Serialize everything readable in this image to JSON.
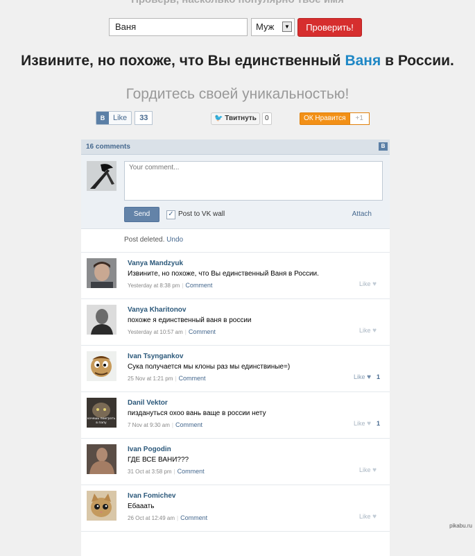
{
  "top_cut": "Проверь, насколько популярно твое имя",
  "form": {
    "name_value": "Ваня",
    "gender_value": "Муж",
    "submit_label": "Проверить!"
  },
  "result": {
    "prefix": "Извините, но похоже, что Вы единственный ",
    "name": "Ваня",
    "suffix": " в России."
  },
  "subtitle": "Гордитесь своей уникальностью!",
  "share": {
    "vk_logo": "B",
    "vk_label": "Like",
    "vk_count": "33",
    "twitter_label": "Твитнуть",
    "twitter_count": "0",
    "ok_label": "Нравится",
    "ok_plus": "+1"
  },
  "widget": {
    "header": "16 comments",
    "header_logo": "B",
    "comment_placeholder": "Your comment...",
    "send_label": "Send",
    "post_to_wall_label": "Post to VK wall",
    "attach_label": "Attach",
    "deleted_text": "Post deleted.",
    "undo_label": "Undo",
    "comments": [
      {
        "author": "Vanya Mandzyuk",
        "text": "Извините, но похоже, что Вы единственный Ваня в России.",
        "time": "Yesterday at 8:38 pm",
        "reply": "Comment",
        "like": "Like",
        "likes": ""
      },
      {
        "author": "Vanya Kharitonov",
        "text": "похоже я единственный ваня в россии",
        "time": "Yesterday at 10:57 am",
        "reply": "Comment",
        "like": "Like",
        "likes": ""
      },
      {
        "author": "Ivan Tsyngankov",
        "text": "Сука получается мы клоны раз мы единствиные=)",
        "time": "25 Nov at 1:21 pm",
        "reply": "Comment",
        "like": "Like",
        "likes": "1"
      },
      {
        "author": "Danil Vektor",
        "text": "пиздануться охоо вань ваще в россии нету",
        "time": "7 Nov at 9:30 am",
        "reply": "Comment",
        "like": "Like",
        "likes": "1"
      },
      {
        "author": "Ivan Pogodin",
        "text": "ГДЕ ВСЕ ВАНИ???",
        "time": "31 Oct at 3:58 pm",
        "reply": "Comment",
        "like": "Like",
        "likes": ""
      },
      {
        "author": "Ivan Fomichev",
        "text": "Ебааать",
        "time": "26 Oct at 12:49 am",
        "reply": "Comment",
        "like": "Like",
        "likes": ""
      }
    ]
  },
  "avatar_text": "хочешь поиграть в папу",
  "watermark": "pikabu.ru"
}
